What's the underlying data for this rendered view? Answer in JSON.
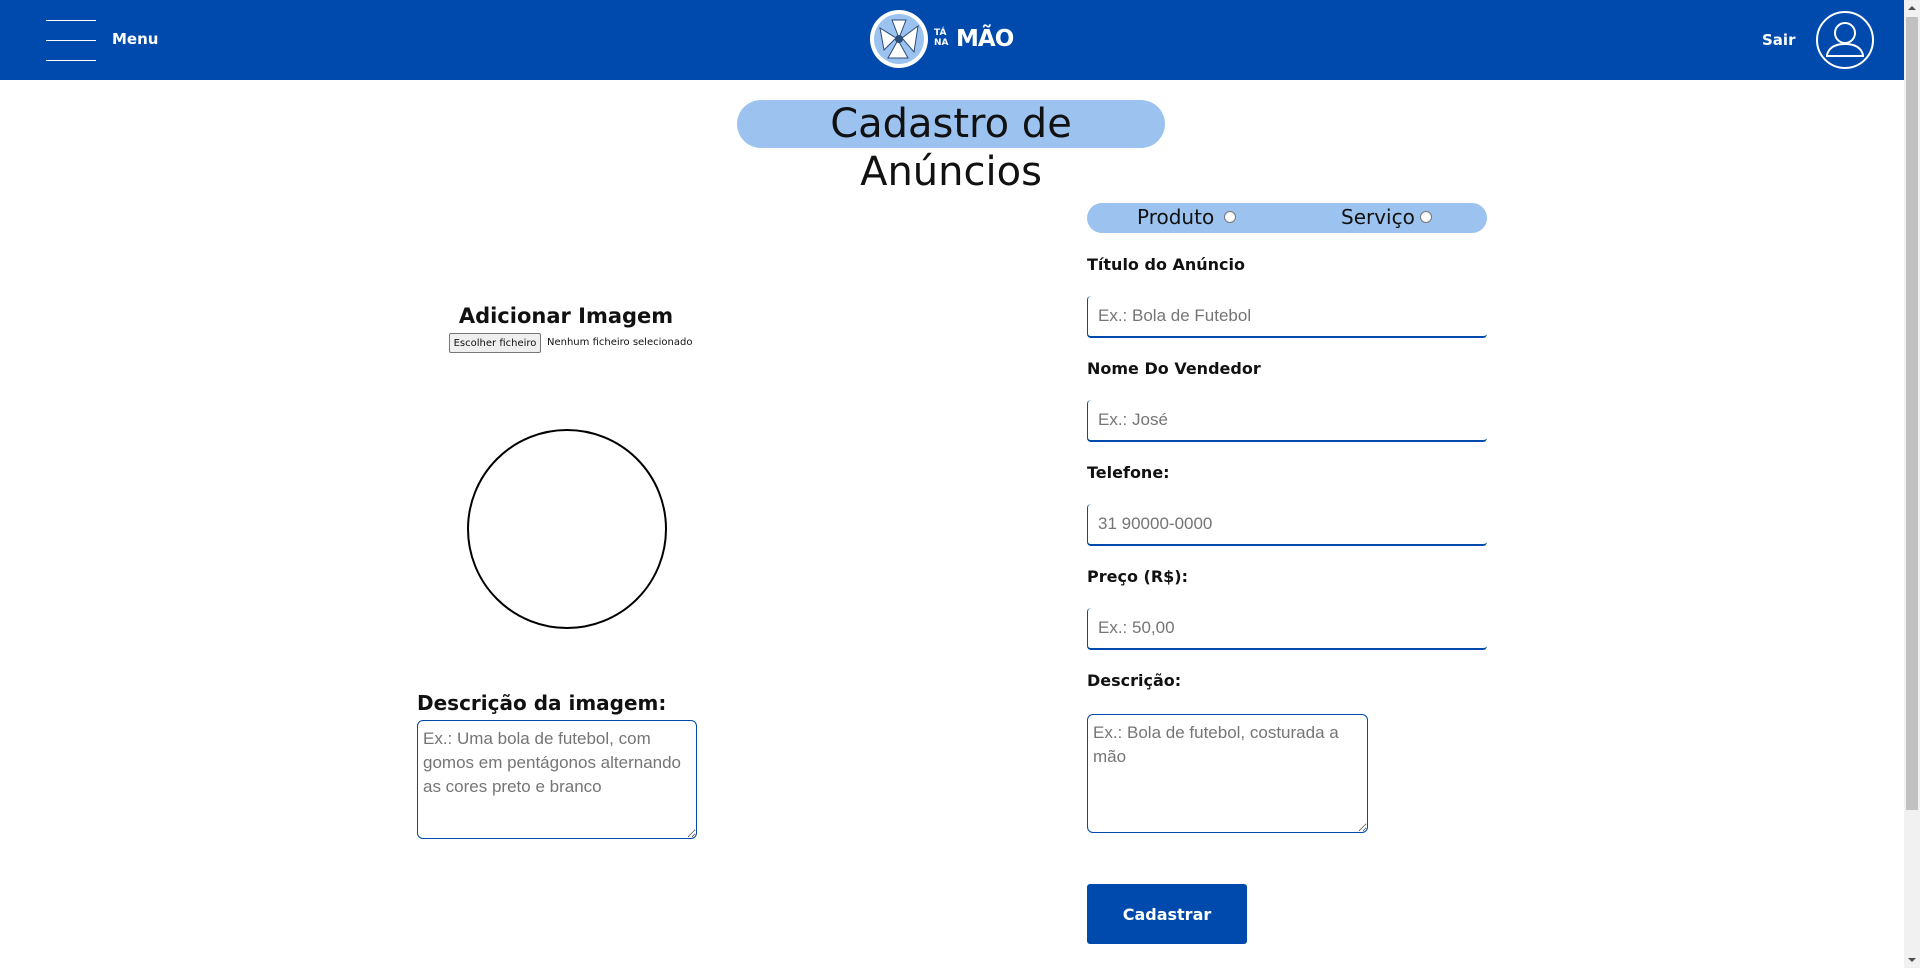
{
  "header": {
    "menu_label": "Menu",
    "logo_small": "TÁ NA",
    "logo_big": "MÃO",
    "logout_label": "Sair",
    "icons": {
      "menu": "hamburger-icon",
      "user": "user-avatar-icon"
    },
    "colors": {
      "bar": "#004aad",
      "accent": "#9cc3ef"
    }
  },
  "page": {
    "title": "Cadastro de Anúncios"
  },
  "image_section": {
    "add_image_label": "Adicionar Imagem",
    "file_button_label": "Escolher ficheiro",
    "file_status": "Nenhum ficheiro selecionado",
    "description_label": "Descrição da imagem:",
    "description_placeholder": "Ex.: Uma bola de futebol, com gomos em pentágonos alternando as cores preto e branco"
  },
  "form": {
    "type_options": [
      {
        "label": "Produto",
        "selected": false
      },
      {
        "label": "Serviço",
        "selected": false
      }
    ],
    "fields": {
      "title": {
        "label": "Título do Anúncio",
        "placeholder": "Ex.: Bola de Futebol",
        "value": ""
      },
      "seller": {
        "label": "Nome Do Vendedor",
        "placeholder": "Ex.: José",
        "value": ""
      },
      "phone": {
        "label": "Telefone:",
        "placeholder": "31 90000-0000",
        "value": ""
      },
      "price": {
        "label": "Preço (R$):",
        "placeholder": "Ex.: 50,00",
        "value": ""
      },
      "description": {
        "label": "Descrição:",
        "placeholder": "Ex.: Bola de futebol, costurada a mão",
        "value": ""
      }
    },
    "submit_label": "Cadastrar"
  }
}
